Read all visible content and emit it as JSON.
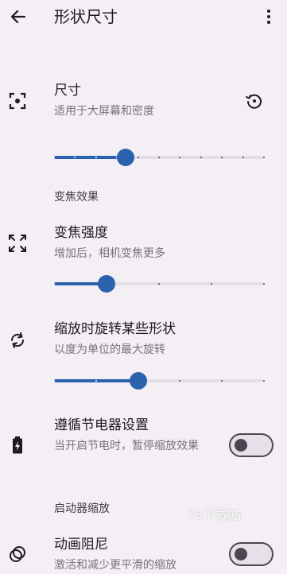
{
  "appbar": {
    "back_icon": "arrow-back-icon",
    "title": "形状尺寸",
    "more_icon": "more-vert-icon"
  },
  "size": {
    "icon": "center-focus-icon",
    "title": "尺寸",
    "subtitle": "适用于大屏幕和密度",
    "reset_icon": "restore-icon",
    "slider_value": 0.34
  },
  "zoom_section": {
    "header": "变焦效果"
  },
  "zoom_strength": {
    "icon": "zoom-out-map-icon",
    "title": "变焦强度",
    "subtitle": "增加后，相机变焦更多",
    "slider_value": 0.25
  },
  "rotate": {
    "icon": "rotate-icon",
    "title": "缩放时旋转某些形状",
    "subtitle": "以度为单位的最大旋转",
    "slider_value": 0.4
  },
  "battery_saver": {
    "icon": "battery-charging-icon",
    "title": "遵循节电器设置",
    "subtitle": "当开启节电时，暂停缩放效果",
    "enabled": false
  },
  "launcher_section": {
    "header": "启动器缩放"
  },
  "damping": {
    "icon": "animation-rings-icon",
    "title": "动画阻尼",
    "subtitle": "激活和减少更平滑的缩放",
    "enabled": false
  },
  "watermark": "78下载站",
  "colors": {
    "background": "#f3eff4",
    "accent": "#2b62ad",
    "track": "#e2dee9",
    "secondary_text": "#77737c"
  }
}
